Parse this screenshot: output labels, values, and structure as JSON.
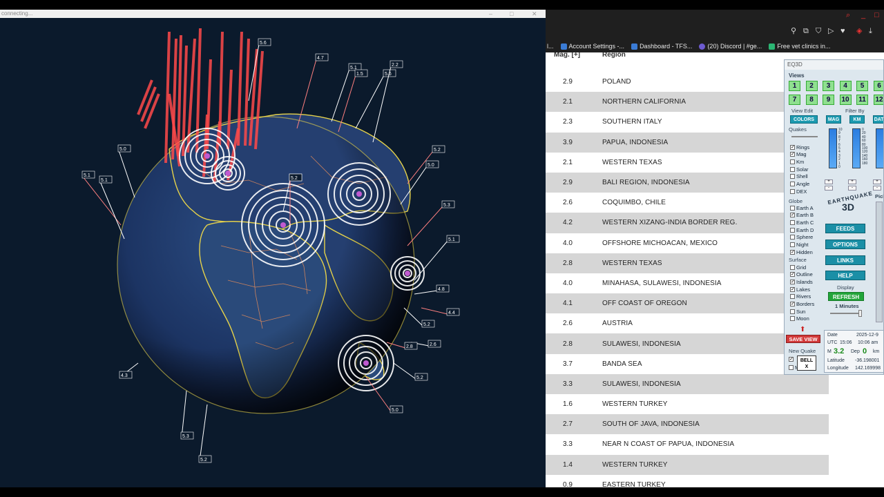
{
  "globe_window": {
    "title": "connecting..."
  },
  "globe": {
    "labels": [
      "4.7",
      "5.0",
      "5.6",
      "5.2",
      "5.1",
      "5.0",
      "5.3",
      "5.1",
      "4.8",
      "4.4",
      "5.2",
      "2.6",
      "2.8",
      "4.3",
      "5.2",
      "5.0",
      "5.3",
      "5.2",
      "5.1",
      "5.1",
      "5.6",
      "1.5",
      "2.2",
      "4.5",
      "5.2"
    ],
    "ring_color": "#ffffff",
    "spike_color": "#ff4a4a"
  },
  "browser": {
    "bookmarks": [
      {
        "label": "Account Settings -...",
        "color": "#3a7bd5"
      },
      {
        "label": "Dashboard - TFS...",
        "color": "#3a7bd5"
      },
      {
        "label": "(20) Discord | #ge...",
        "color": "#6d5bd0"
      },
      {
        "label": "Free vet clinics in...",
        "color": "#2bb673"
      }
    ],
    "first_bookmark_fragment": "l..."
  },
  "list": {
    "header_mag": "Mag. [+]",
    "header_region": "Region",
    "rows": [
      {
        "mag": "2.9",
        "region": "POLAND"
      },
      {
        "mag": "2.1",
        "region": "NORTHERN CALIFORNIA"
      },
      {
        "mag": "2.3",
        "region": "SOUTHERN ITALY"
      },
      {
        "mag": "3.9",
        "region": "PAPUA, INDONESIA"
      },
      {
        "mag": "2.1",
        "region": "WESTERN TEXAS"
      },
      {
        "mag": "2.9",
        "region": "BALI REGION, INDONESIA"
      },
      {
        "mag": "2.6",
        "region": "COQUIMBO, CHILE"
      },
      {
        "mag": "4.2",
        "region": "WESTERN XIZANG-INDIA BORDER REG."
      },
      {
        "mag": "4.0",
        "region": "OFFSHORE MICHOACAN, MEXICO"
      },
      {
        "mag": "2.8",
        "region": "WESTERN TEXAS"
      },
      {
        "mag": "4.0",
        "region": "MINAHASA, SULAWESI, INDONESIA"
      },
      {
        "mag": "4.1",
        "region": "OFF COAST OF OREGON"
      },
      {
        "mag": "2.6",
        "region": "AUSTRIA"
      },
      {
        "mag": "2.8",
        "region": "SULAWESI, INDONESIA"
      },
      {
        "mag": "3.7",
        "region": "BANDA SEA"
      },
      {
        "mag": "3.3",
        "region": "SULAWESI, INDONESIA"
      },
      {
        "mag": "1.6",
        "region": "WESTERN TURKEY"
      },
      {
        "mag": "2.7",
        "region": "SOUTH OF JAVA, INDONESIA"
      },
      {
        "mag": "3.3",
        "region": "NEAR N COAST OF PAPUA, INDONESIA"
      },
      {
        "mag": "1.4",
        "region": "WESTERN TURKEY"
      },
      {
        "mag": "0.9",
        "region": "EASTERN TURKEY"
      }
    ]
  },
  "eq3d": {
    "title": "EQ3D",
    "views_label": "Views",
    "view_buttons": [
      "1",
      "2",
      "3",
      "4",
      "5",
      "6",
      "7",
      "8",
      "9",
      "10",
      "11",
      "12"
    ],
    "view_edit_label": "View Edit",
    "filter_by_label": "Filter By",
    "colors_btn": "COLORS",
    "mag_btn": "MAG",
    "km_btn": "KM",
    "date_btn": "DATE",
    "quakes_label": "Quakes",
    "quake_checks": [
      {
        "label": "Rings",
        "on": true
      },
      {
        "label": "Mag",
        "on": true
      },
      {
        "label": "Km",
        "on": false
      },
      {
        "label": "Solar",
        "on": false
      },
      {
        "label": "Shell",
        "on": false
      },
      {
        "label": "Angle",
        "on": false
      },
      {
        "label": "DEX",
        "on": false
      }
    ],
    "globe_label": "Globe",
    "globe_checks": [
      {
        "label": "Earth A",
        "on": false
      },
      {
        "label": "Earth B",
        "on": true
      },
      {
        "label": "Earth C",
        "on": false
      },
      {
        "label": "Earth D",
        "on": false
      },
      {
        "label": "Sphere",
        "on": false
      },
      {
        "label": "Night",
        "on": false
      },
      {
        "label": "Hidden",
        "on": true
      }
    ],
    "surface_label": "Surface",
    "surface_checks": [
      {
        "label": "Grid",
        "on": false
      },
      {
        "label": "Outline",
        "on": true
      },
      {
        "label": "Islands",
        "on": true
      },
      {
        "label": "Lakes",
        "on": true
      },
      {
        "label": "Rivers",
        "on": false
      },
      {
        "label": "Borders",
        "on": true
      },
      {
        "label": "Sun",
        "on": false
      },
      {
        "label": "Moon",
        "on": false
      }
    ],
    "mag_ticks": [
      "10",
      "9",
      "8",
      "7",
      "6",
      "5",
      "4",
      "3",
      "2",
      "1",
      "0"
    ],
    "km_ticks": [
      "0",
      "20",
      "40",
      "60",
      "80",
      "100",
      "120",
      "140",
      "160",
      "180"
    ],
    "logo_line1": "EARTHQUAKE",
    "logo_line2": "3D",
    "feeds_btn": "FEEDS",
    "options_btn": "OPTIONS",
    "links_btn": "LINKS",
    "help_btn": "HELP",
    "display_label": "Display",
    "refresh_btn": "REFRESH",
    "refresh_interval": "1 Minutes",
    "pick_label": "Pick",
    "save_view_btn": "SAVE VIEW",
    "new_quake_label": "New Quake",
    "bell_label": "BELL",
    "bell_x": "X",
    "m_label": "M",
    "info": {
      "date_label": "Date",
      "date_value": "2025-12-9",
      "utc_label": "UTC",
      "utc_value": "15:06",
      "local_value": "10:06 am",
      "m_label": "M",
      "mag_value": "3.2",
      "dep_label": "Dep",
      "dep_value": "0",
      "km_label": "km",
      "lat_label": "Latitude",
      "lat_value": "-36.198001",
      "lon_label": "Longitude",
      "lon_value": "142.169998"
    }
  }
}
